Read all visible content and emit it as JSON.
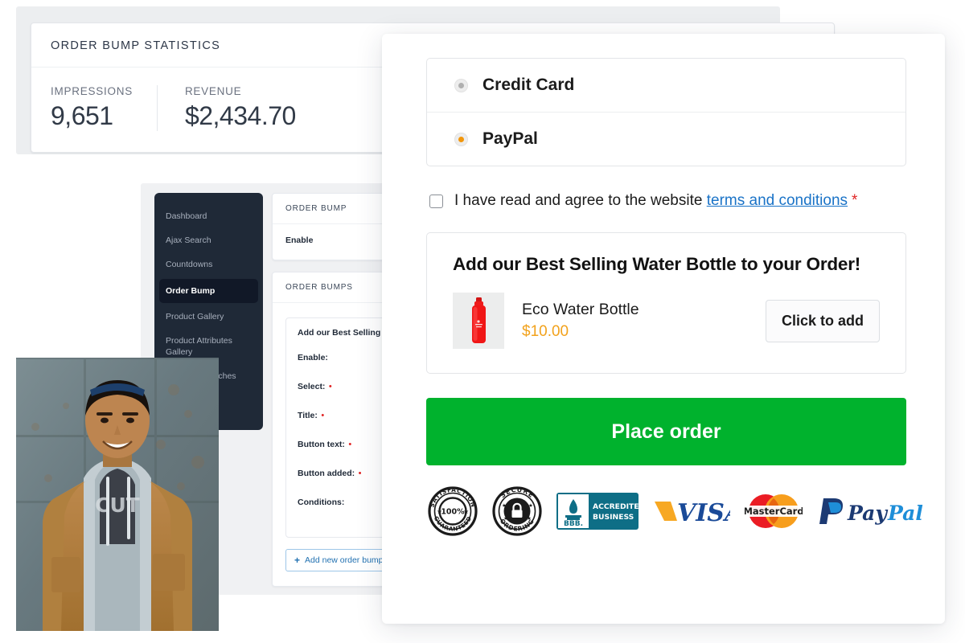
{
  "stats": {
    "title": "ORDER BUMP STATISTICS",
    "metrics": [
      {
        "label": "IMPRESSIONS",
        "value": "9,651"
      },
      {
        "label": "REVENUE",
        "value": "$2,434.70"
      }
    ]
  },
  "admin": {
    "sidebar": [
      {
        "label": "Dashboard",
        "active": false
      },
      {
        "label": "Ajax Search",
        "active": false
      },
      {
        "label": "Countdowns",
        "active": false
      },
      {
        "label": "Order Bump",
        "active": true
      },
      {
        "label": "Product Gallery",
        "active": false
      },
      {
        "label": "Product Attributes Gallery",
        "active": false
      },
      {
        "label": "Attribute Swatches",
        "active": false
      }
    ],
    "panel_one": {
      "heading": "ORDER BUMP",
      "enable_label": "Enable"
    },
    "panel_two": {
      "heading": "ORDER BUMPS",
      "bump_title": "Add our Best Selling Water",
      "fields": [
        {
          "label": "Enable:",
          "required": false
        },
        {
          "label": "Select:",
          "required": true
        },
        {
          "label": "Title:",
          "required": true
        },
        {
          "label": "Button text:",
          "required": true
        },
        {
          "label": "Button added:",
          "required": true
        },
        {
          "label": "Conditions:",
          "required": false
        }
      ],
      "add_button": "Add new order bump",
      "add_button_icon": "plus-icon"
    }
  },
  "checkout": {
    "payment_methods": [
      {
        "label": "Credit Card",
        "selected": false,
        "dot_color": "#b0b0b0"
      },
      {
        "label": "PayPal",
        "selected": true,
        "dot_color": "#f2960b"
      }
    ],
    "terms": {
      "text_before": "I have read and agree to the website",
      "link_text": "terms and conditions",
      "required_mark": "*",
      "checked": false
    },
    "offer": {
      "title": "Add our Best Selling Water Bottle to your Order!",
      "product_name": "Eco Water Bottle",
      "product_price": "$10.00",
      "price_color": "#f2a21c",
      "cta_label": "Click to add",
      "thumb_icon": "water-bottle-image"
    },
    "place_order_label": "Place order",
    "place_order_color": "#00b22d",
    "trust_badges": [
      {
        "name": "satisfaction-guaranteed-badge",
        "line1": "SATISFACTION",
        "center": "100%",
        "line2": "GUARANTEED"
      },
      {
        "name": "secure-ordering-badge",
        "line1": "SECURE",
        "center": "lock-icon",
        "line2": "ORDERING"
      },
      {
        "name": "bbb-accredited-business-badge",
        "line1": "ACCREDITED",
        "line2": "BUSINESS",
        "mark": "BBB."
      },
      {
        "name": "visa-badge",
        "label": "VISA"
      },
      {
        "name": "mastercard-badge",
        "label": "MasterCard"
      },
      {
        "name": "paypal-badge",
        "label": "PayPal"
      }
    ]
  },
  "photo": {
    "alt": "smiling-young-man-in-tan-jacket"
  }
}
